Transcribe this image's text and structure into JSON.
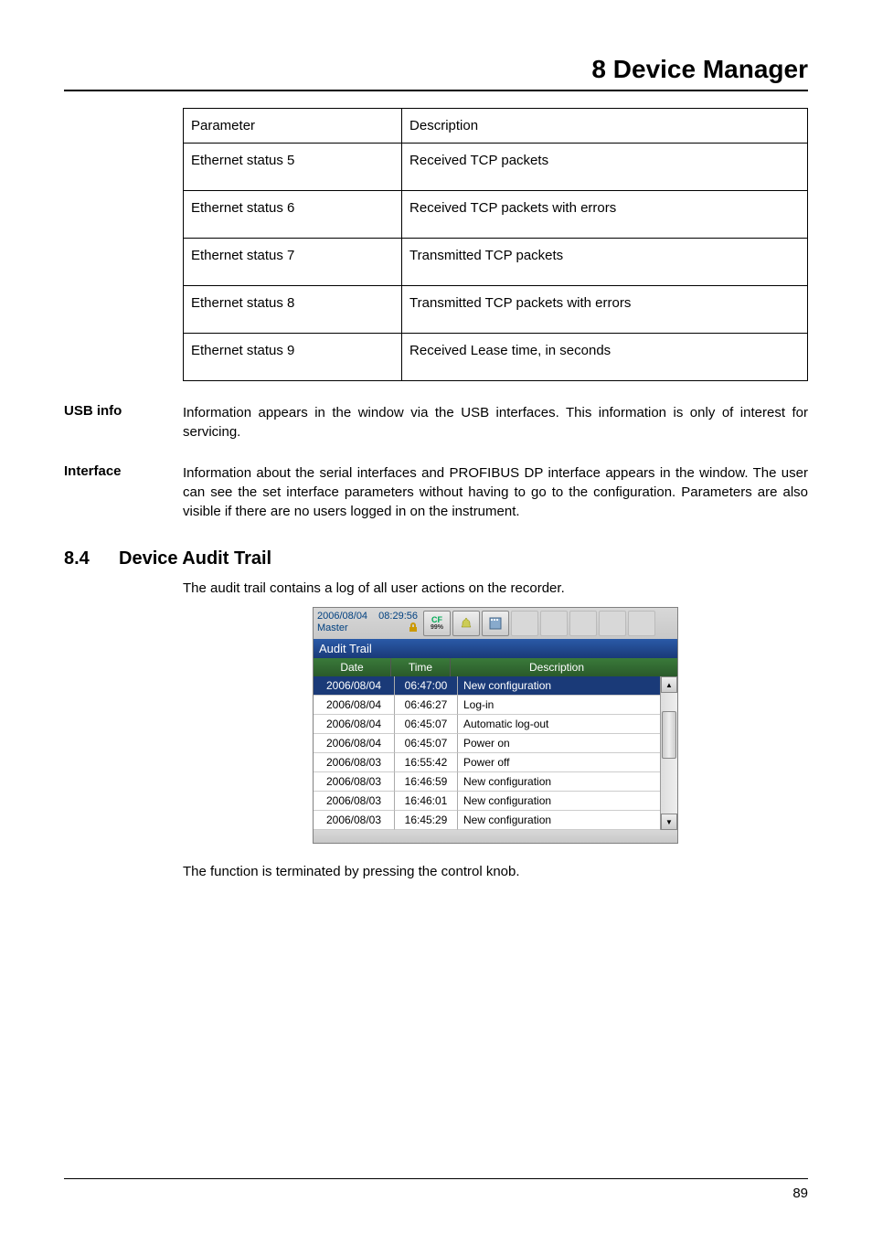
{
  "header": {
    "chapter_title": "8 Device Manager"
  },
  "param_table": {
    "col1": "Parameter",
    "col2": "Description",
    "rows": [
      {
        "p": "Ethernet status 5",
        "d": "Received TCP packets"
      },
      {
        "p": "Ethernet status 6",
        "d": "Received TCP packets with errors"
      },
      {
        "p": "Ethernet status 7",
        "d": "Transmitted TCP packets"
      },
      {
        "p": "Ethernet status 8",
        "d": "Transmitted TCP packets with errors"
      },
      {
        "p": "Ethernet status 9",
        "d": "Received Lease time, in seconds"
      }
    ]
  },
  "usb_info": {
    "label": "USB info",
    "text": "Information appears in the window via the USB interfaces. This information is only of interest for servicing."
  },
  "interface": {
    "label": "Interface",
    "text": "Information about the serial interfaces and PROFIBUS DP interface appears in the window. The user can see the set interface parameters without having to go to the configuration. Parameters are also visible if there are no users logged in on the instrument."
  },
  "section": {
    "num": "8.4",
    "title": "Device Audit Trail",
    "intro": "The audit trail contains a log of all user actions on the recorder.",
    "outro": "The function is terminated by pressing the control knob."
  },
  "screenshot": {
    "date": "2006/08/04",
    "time": "08:29:56",
    "user": "Master",
    "cf_label": "CF",
    "cf_pct": "99%",
    "title": "Audit Trail",
    "headers": {
      "date": "Date",
      "time": "Time",
      "desc": "Description"
    },
    "rows": [
      {
        "date": "2006/08/04",
        "time": "06:47:00",
        "desc": "New configuration",
        "selected": true
      },
      {
        "date": "2006/08/04",
        "time": "06:46:27",
        "desc": "Log-in",
        "selected": false
      },
      {
        "date": "2006/08/04",
        "time": "06:45:07",
        "desc": "Automatic log-out",
        "selected": false
      },
      {
        "date": "2006/08/04",
        "time": "06:45:07",
        "desc": "Power on",
        "selected": false
      },
      {
        "date": "2006/08/03",
        "time": "16:55:42",
        "desc": "Power off",
        "selected": false
      },
      {
        "date": "2006/08/03",
        "time": "16:46:59",
        "desc": "New configuration",
        "selected": false
      },
      {
        "date": "2006/08/03",
        "time": "16:46:01",
        "desc": "New configuration",
        "selected": false
      },
      {
        "date": "2006/08/03",
        "time": "16:45:29",
        "desc": "New configuration",
        "selected": false
      }
    ]
  },
  "page_number": "89"
}
